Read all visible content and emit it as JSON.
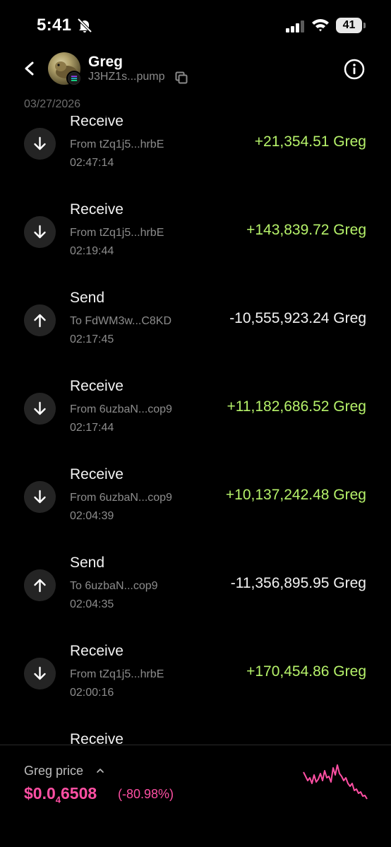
{
  "status_bar": {
    "time": "5:41",
    "battery": "41"
  },
  "header": {
    "token_name": "Greg",
    "address": "J3HZ1s...pump",
    "date": "03/27/2026"
  },
  "transactions": [
    {
      "type": "Receive",
      "direction": "in",
      "party": "From tZq1j5...hrbE",
      "time": "02:47:14",
      "amount": "+21,354.51 Greg"
    },
    {
      "type": "Receive",
      "direction": "in",
      "party": "From tZq1j5...hrbE",
      "time": "02:19:44",
      "amount": "+143,839.72 Greg"
    },
    {
      "type": "Send",
      "direction": "out",
      "party": "To FdWM3w...C8KD",
      "time": "02:17:45",
      "amount": "-10,555,923.24 Greg"
    },
    {
      "type": "Receive",
      "direction": "in",
      "party": "From 6uzbaN...cop9",
      "time": "02:17:44",
      "amount": "+11,182,686.52 Greg"
    },
    {
      "type": "Receive",
      "direction": "in",
      "party": "From 6uzbaN...cop9",
      "time": "02:04:39",
      "amount": "+10,137,242.48 Greg"
    },
    {
      "type": "Send",
      "direction": "out",
      "party": "To 6uzbaN...cop9",
      "time": "02:04:35",
      "amount": "-11,356,895.95 Greg"
    },
    {
      "type": "Receive",
      "direction": "in",
      "party": "From tZq1j5...hrbE",
      "time": "02:00:16",
      "amount": "+170,454.86 Greg"
    },
    {
      "type": "Receive",
      "direction": "in",
      "party": "",
      "time": "",
      "amount": ""
    }
  ],
  "price_panel": {
    "label": "Greg price",
    "price_prefix": "$0.0",
    "price_subscript": "4",
    "price_suffix": "6508",
    "change": "(-80.98%)",
    "accent_color": "#ff4fa3"
  },
  "colors": {
    "positive": "#b6f26a",
    "negative": "#f2f2f2",
    "background": "#000000"
  }
}
